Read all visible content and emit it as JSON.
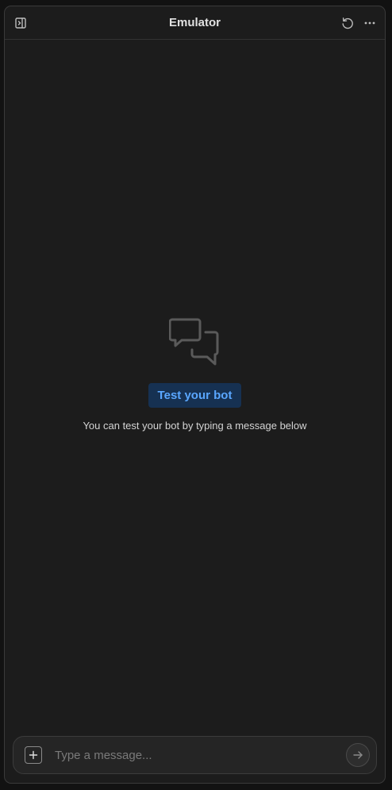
{
  "header": {
    "title": "Emulator",
    "left_icon": "sidebar-toggle-icon",
    "right_icons": [
      "reset-icon",
      "more-horizontal-icon"
    ]
  },
  "empty_state": {
    "icon": "chat-bubbles-icon",
    "badge_label": "Test your bot",
    "hint": "You can test your bot by typing a message below"
  },
  "composer": {
    "add_icon": "plus-icon",
    "placeholder": "Type a message...",
    "value": "",
    "send_icon": "arrow-right-icon"
  },
  "colors": {
    "background": "#1c1c1c",
    "badge_bg": "#163152",
    "badge_text": "#5aa7ff"
  }
}
